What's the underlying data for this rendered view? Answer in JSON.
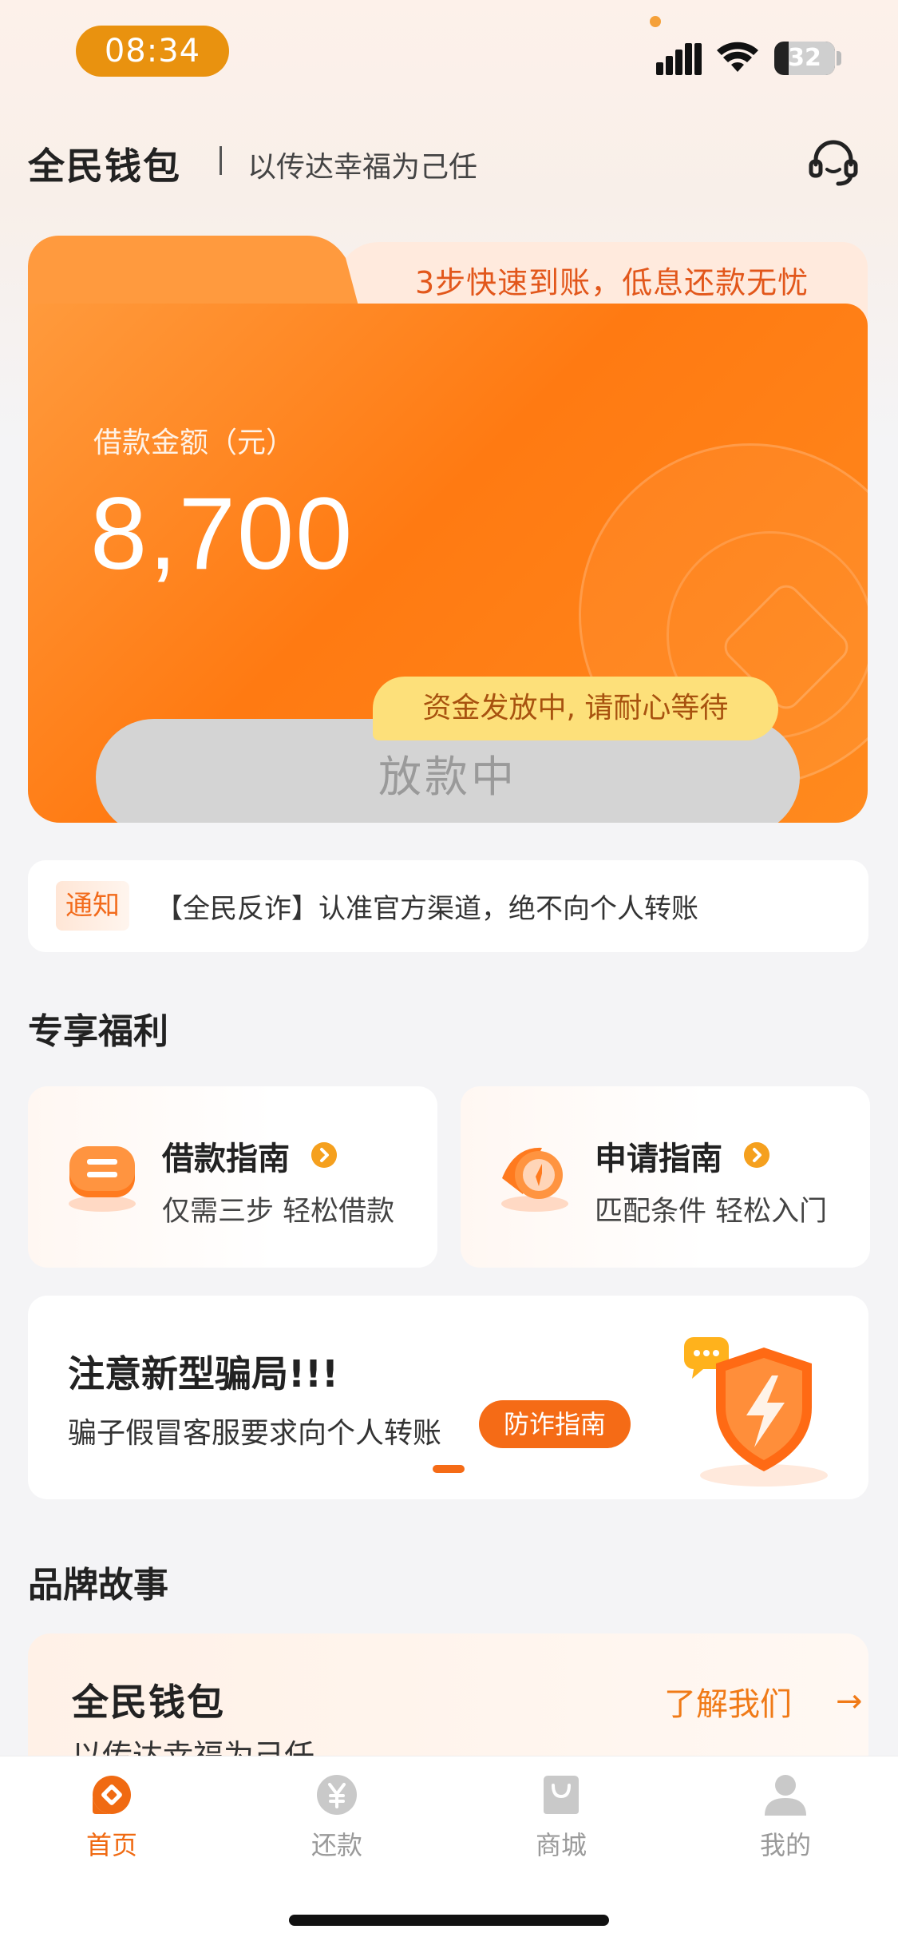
{
  "status_bar": {
    "time": "08:34",
    "battery": "32"
  },
  "header": {
    "app_name": "全民钱包",
    "slogan": "以传达幸福为己任"
  },
  "loan_card": {
    "tab_label": "3步快速到账，低息还款无忧",
    "amount_label": "借款金额（元）",
    "amount": "8,700",
    "tip": "资金发放中, 请耐心等待",
    "button_label": "放款中"
  },
  "notice": {
    "tag": "通知",
    "text": "【全民反诈】认准官方渠道，绝不向个人转账"
  },
  "benefits": {
    "title": "专享福利",
    "items": [
      {
        "title": "借款指南",
        "subtitle": "仅需三步 轻松借款"
      },
      {
        "title": "申请指南",
        "subtitle": "匹配条件 轻松入门"
      }
    ]
  },
  "fraud_banner": {
    "title": "注意新型骗局!!!",
    "description": "骗子假冒客服要求向个人转账",
    "button_label": "防诈指南"
  },
  "brand": {
    "section_title": "品牌故事",
    "name": "全民钱包",
    "slogan": "以传达幸福为己任",
    "link_label": "了解我们",
    "link_arrow": "→"
  },
  "tab_bar": {
    "items": [
      {
        "label": "首页",
        "icon": "home-icon",
        "active": true
      },
      {
        "label": "还款",
        "icon": "repay-icon",
        "active": false
      },
      {
        "label": "商城",
        "icon": "shop-icon",
        "active": false
      },
      {
        "label": "我的",
        "icon": "profile-icon",
        "active": false
      }
    ]
  },
  "colors": {
    "accent": "#f56b16",
    "active_tab": "#f06a12",
    "inactive_tab": "#9a9a9a"
  }
}
